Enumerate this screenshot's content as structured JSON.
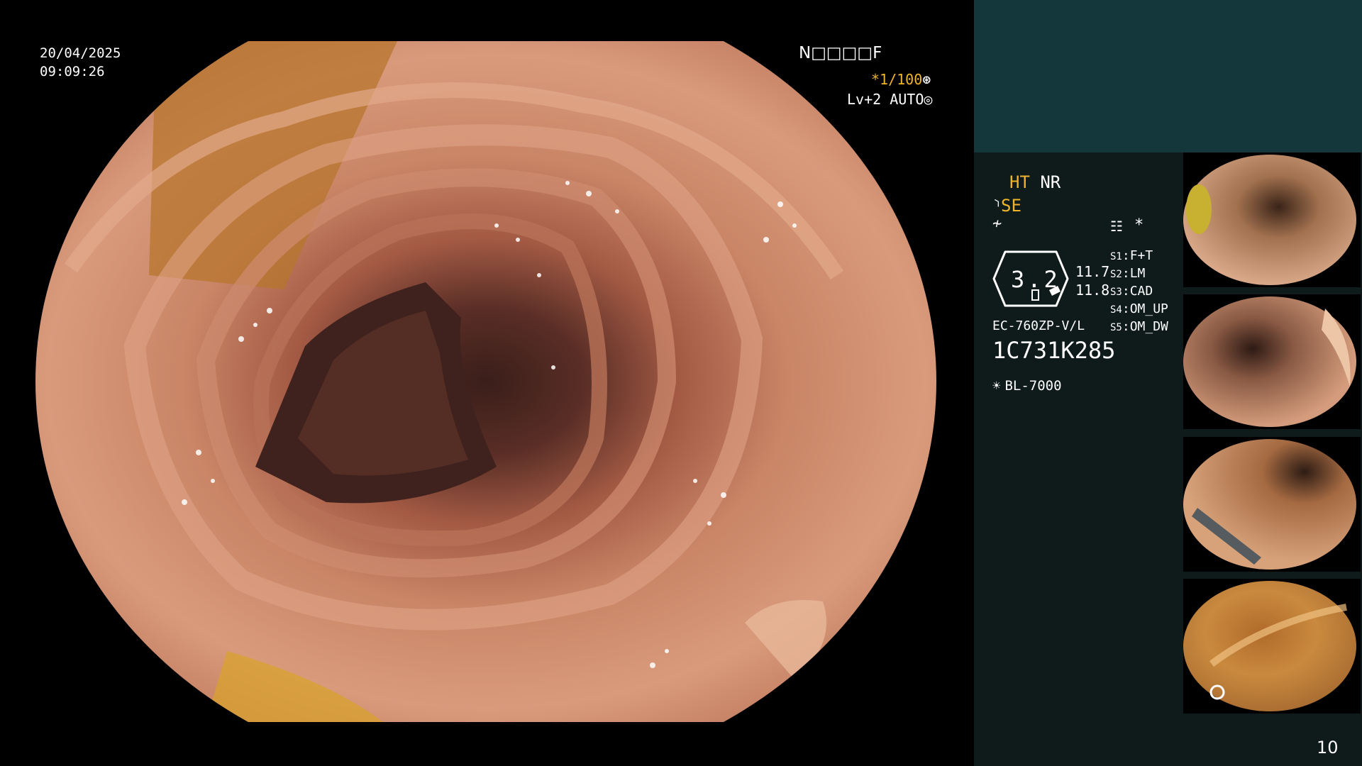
{
  "overlay": {
    "date": "20/04/2025",
    "time": "09:09:26",
    "procedure_id": "N□□□□F",
    "shutter": "*1/100",
    "shutter_icon": "⊛",
    "level": "Lv+2 AUTO",
    "level_icon": "◎"
  },
  "panel": {
    "ht": "HT",
    "nr": "NR",
    "se_icon": "⸃",
    "se": "SE",
    "fx_icon": "≁",
    "menu_icon": "☷",
    "star": "*",
    "zoom": "3.2",
    "value1": "11.7",
    "value2": "11.8",
    "settings": [
      {
        "key": "S1",
        "value": "F+T"
      },
      {
        "key": "S2",
        "value": "LM"
      },
      {
        "key": "S3",
        "value": "CAD"
      },
      {
        "key": "S4",
        "value": "OM_UP"
      },
      {
        "key": "S5",
        "value": "OM_DW"
      }
    ],
    "model": "EC-760ZP-V/L",
    "serial": "1C731K285",
    "light_icon": "☀",
    "light": "BL-7000"
  },
  "page_number": "10",
  "colors": {
    "accent": "#f0b42a",
    "panel_top": "#13373a",
    "panel": "#0f1a1a"
  }
}
